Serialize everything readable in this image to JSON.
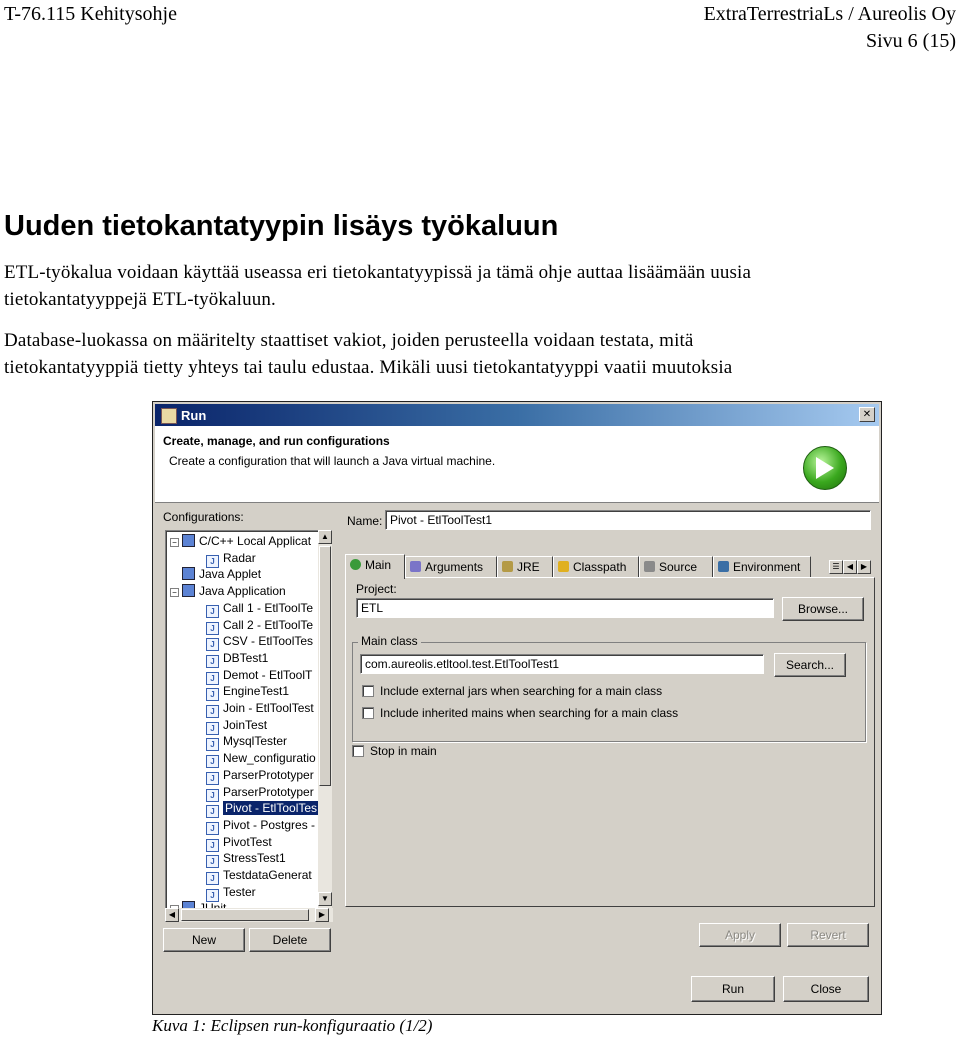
{
  "header": {
    "doc_code": "T-76.115 Kehitysohje",
    "company": "ExtraTerrestriaLs / Aureolis Oy",
    "page": "Sivu 6 (15)"
  },
  "section_title": "Uuden tietokantatyypin lisäys työkaluun",
  "paragraphs": [
    [
      "ETL-työkalua voidaan käyttää useassa eri tietokantatyypissä ja tämä ohje auttaa lisäämään uusia",
      "tietokantatyyppejä ETL-työkaluun."
    ],
    [
      "Database-luokassa on määritelty staattiset vakiot, joiden perusteella voidaan testata, mitä",
      "tietokantatyyppiä tietty yhteys tai taulu edustaa. Mikäli uusi tietokantatyyppi vaatii muutoksia"
    ]
  ],
  "dialog": {
    "title": "Run",
    "banner_title": "Create, manage, and run configurations",
    "banner_desc": "Create a configuration that will launch a Java virtual machine.",
    "configurations_label": "Configurations:",
    "tree": [
      {
        "label": "C/C++ Local Applicat",
        "level": 0,
        "type": "category",
        "expander": "−"
      },
      {
        "label": "Radar",
        "level": 1,
        "type": "item"
      },
      {
        "label": "Java Applet",
        "level": 0,
        "type": "category"
      },
      {
        "label": "Java Application",
        "level": 0,
        "type": "category",
        "expander": "−"
      },
      {
        "label": "Call 1 - EtlToolTe",
        "level": 1,
        "type": "item"
      },
      {
        "label": "Call 2 - EtlToolTe",
        "level": 1,
        "type": "item"
      },
      {
        "label": "CSV - EtlToolTes",
        "level": 1,
        "type": "item"
      },
      {
        "label": "DBTest1",
        "level": 1,
        "type": "item"
      },
      {
        "label": "Demot - EtlToolT",
        "level": 1,
        "type": "item"
      },
      {
        "label": "EngineTest1",
        "level": 1,
        "type": "item"
      },
      {
        "label": "Join - EtlToolTest",
        "level": 1,
        "type": "item"
      },
      {
        "label": "JoinTest",
        "level": 1,
        "type": "item"
      },
      {
        "label": "MysqlTester",
        "level": 1,
        "type": "item"
      },
      {
        "label": "New_configuratio",
        "level": 1,
        "type": "item"
      },
      {
        "label": "ParserPrototyper",
        "level": 1,
        "type": "item"
      },
      {
        "label": "ParserPrototyper",
        "level": 1,
        "type": "item"
      },
      {
        "label": "Pivot - EtlToolTes",
        "level": 1,
        "type": "item",
        "selected": true
      },
      {
        "label": "Pivot - Postgres -",
        "level": 1,
        "type": "item"
      },
      {
        "label": "PivotTest",
        "level": 1,
        "type": "item"
      },
      {
        "label": "StressTest1",
        "level": 1,
        "type": "item"
      },
      {
        "label": "TestdataGenerat",
        "level": 1,
        "type": "item"
      },
      {
        "label": "Tester",
        "level": 1,
        "type": "item"
      },
      {
        "label": "JUnit",
        "level": 0,
        "type": "category",
        "expander": "−"
      }
    ],
    "name_label": "Name:",
    "name_value": "Pivot - EtlToolTest1",
    "tabs": [
      "Main",
      "Arguments",
      "JRE",
      "Classpath",
      "Source",
      "Environment"
    ],
    "project_label": "Project:",
    "project_value": "ETL",
    "browse_button": "Browse...",
    "main_class_label": "Main class",
    "main_class_value": "com.aureolis.etltool.test.EtlToolTest1",
    "search_button": "Search...",
    "cb_external_jars": "Include external jars when searching for a main class",
    "cb_inherited_mains": "Include inherited mains when searching for a main class",
    "cb_stop_in_main": "Stop in main",
    "new_button": "New",
    "delete_button": "Delete",
    "apply_button": "Apply",
    "revert_button": "Revert",
    "run_button": "Run",
    "close_button": "Close"
  },
  "caption": "Kuva 1: Eclipsen run-konfiguraatio (1/2)"
}
